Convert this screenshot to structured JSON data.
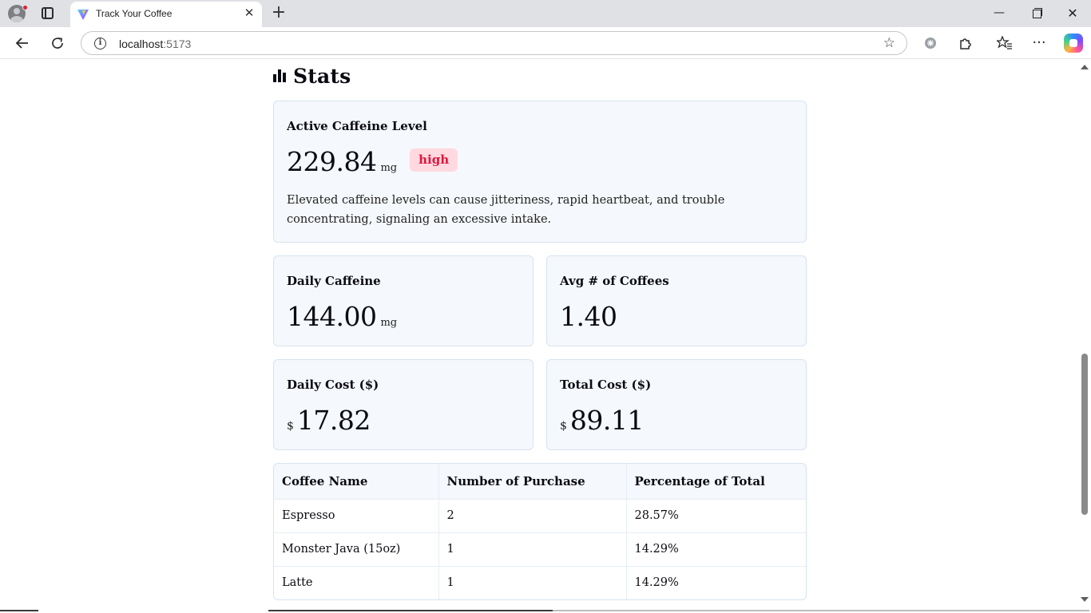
{
  "browser": {
    "tab_title": "Track Your Coffee",
    "url_host": "localhost",
    "url_port": ":5173",
    "icons": [
      "profile-icon",
      "tab-actions-icon",
      "vite-favicon",
      "close-tab-icon",
      "new-tab-icon",
      "minimize-icon",
      "restore-icon",
      "close-window-icon",
      "back-icon",
      "refresh-icon",
      "site-info-icon",
      "favorite-star-icon",
      "extension-icon",
      "puzzle-icon",
      "favorites-icon",
      "more-icon",
      "copilot-icon"
    ]
  },
  "page": {
    "heading": "Stats",
    "active_caffeine": {
      "title": "Active Caffeine Level",
      "value": "229.84",
      "unit": "mg",
      "badge": "high",
      "badge_color": "#e0163d",
      "description": "Elevated caffeine levels can cause jitteriness, rapid heartbeat, and trouble concentrating, signaling an excessive intake."
    },
    "daily_caffeine": {
      "title": "Daily Caffeine",
      "value": "144.00",
      "unit": "mg"
    },
    "avg_coffees": {
      "title": "Avg # of Coffees",
      "value": "1.40"
    },
    "daily_cost": {
      "title": "Daily Cost ($)",
      "currency": "$",
      "value": "17.82"
    },
    "total_cost": {
      "title": "Total Cost ($)",
      "currency": "$",
      "value": "89.11"
    },
    "table": {
      "headers": [
        "Coffee Name",
        "Number of Purchase",
        "Percentage of Total"
      ],
      "rows": [
        [
          "Espresso",
          "2",
          "28.57%"
        ],
        [
          "Monster Java (15oz)",
          "1",
          "14.29%"
        ],
        [
          "Latte",
          "1",
          "14.29%"
        ]
      ]
    }
  }
}
